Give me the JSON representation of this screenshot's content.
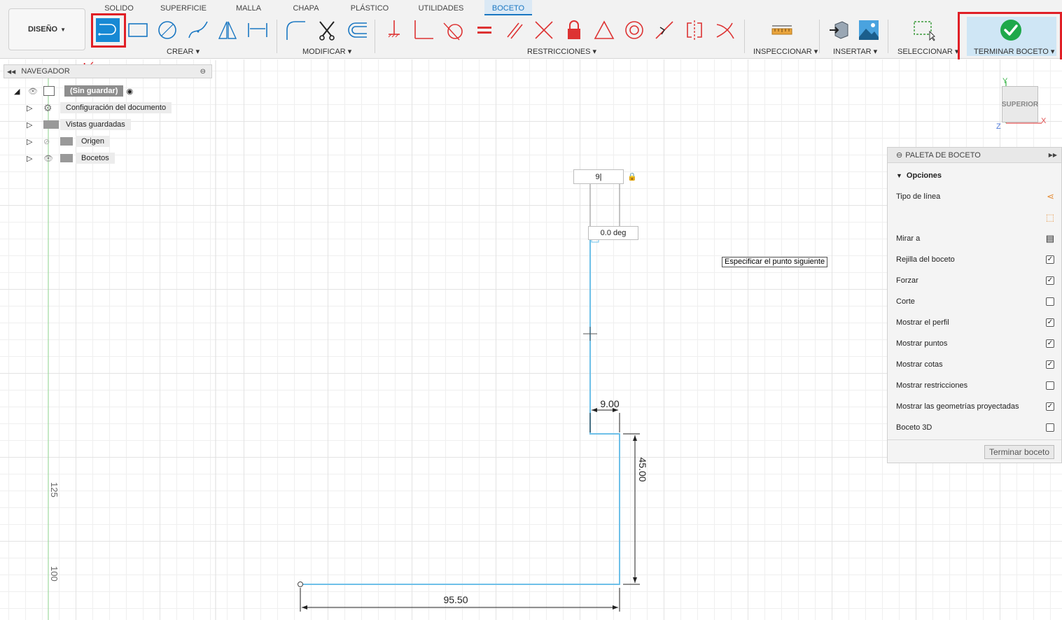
{
  "tabs": [
    "SOLIDO",
    "SUPERFICIE",
    "MALLA",
    "CHAPA",
    "PLÁSTICO",
    "UTILIDADES",
    "BOCETO"
  ],
  "design_button": "DISEÑO",
  "groups": {
    "create": "CREAR",
    "modify": "MODIFICAR",
    "constraints": "RESTRICCIONES",
    "inspect": "INSPECCIONAR",
    "insert": "INSERTAR",
    "select": "SELECCIONAR",
    "finish": "TERMINAR BOCETO"
  },
  "annotation_label": "Línea",
  "colors": {
    "accent": "#1789d4",
    "highlight": "#e01f26",
    "sketch_line": "#6ec0e8",
    "finish_green": "#1ea84a"
  },
  "navigator": {
    "title": "NAVEGADOR",
    "root": "(Sin guardar)",
    "items": [
      "Configuración del documento",
      "Vistas guardadas",
      "Origen",
      "Bocetos"
    ]
  },
  "palette": {
    "title": "PALETA DE BOCETO",
    "section": "Opciones",
    "rows": [
      {
        "label": "Tipo de línea",
        "kind": "icon"
      },
      {
        "label": "",
        "kind": "icon"
      },
      {
        "label": "Mirar a",
        "kind": "icon"
      },
      {
        "label": "Rejilla del boceto",
        "checked": true
      },
      {
        "label": "Forzar",
        "checked": true
      },
      {
        "label": "Corte",
        "checked": false
      },
      {
        "label": "Mostrar el perfil",
        "checked": true
      },
      {
        "label": "Mostrar puntos",
        "checked": true
      },
      {
        "label": "Mostrar cotas",
        "checked": true
      },
      {
        "label": "Mostrar restricciones",
        "checked": false
      },
      {
        "label": "Mostrar las geometrías proyectadas",
        "checked": true
      },
      {
        "label": "Boceto 3D",
        "checked": false
      }
    ],
    "finish_button": "Terminar boceto"
  },
  "sketch": {
    "length_input": "9",
    "angle_input": "0.0 deg",
    "tooltip": "Especificar el punto siguiente",
    "dims": {
      "horizontal_bottom": "95.50",
      "vertical_right": "45.00",
      "step_width": "9.00"
    },
    "ruler_ticks": [
      "125",
      "100"
    ]
  },
  "viewcube": {
    "face": "SUPERIOR",
    "axis_x": "X",
    "axis_y": "Y",
    "axis_z": "Z"
  }
}
